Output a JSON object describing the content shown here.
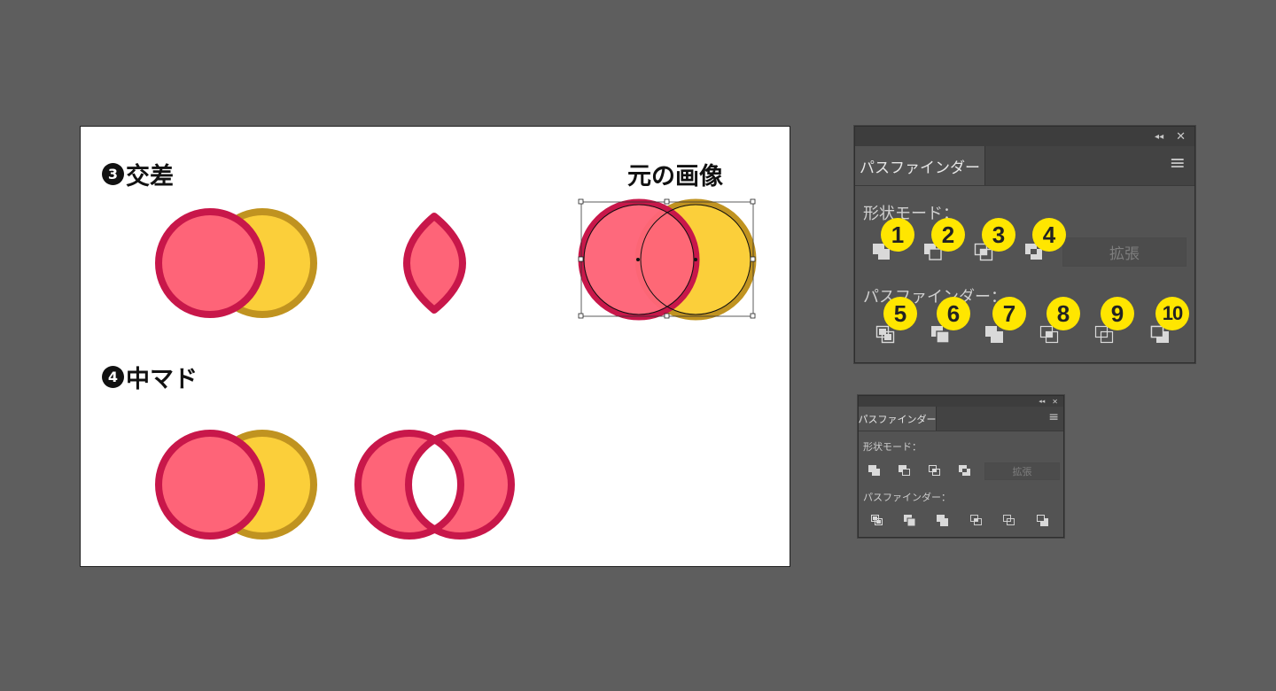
{
  "artboard": {
    "label_intersect_num": "3",
    "label_intersect": "交差",
    "label_original": "元の画像",
    "label_minus_back_num": "4",
    "label_minus_back": "中マド"
  },
  "colors": {
    "red_fill": "#fe6478",
    "red_stroke": "#c8174a",
    "yellow_fill": "#fbcf3a",
    "yellow_stroke": "#c09320",
    "marker": "#ffe600",
    "panel_bg": "#535353"
  },
  "panel_large": {
    "collapse_icon": "double-chevron-left-icon",
    "close_icon": "close-icon",
    "collapse_glyph": "◂◂",
    "close_glyph": "✕",
    "tab_label": "パスファインダー",
    "menu_glyph": "≡",
    "shape_modes_label": "形状モード：",
    "pathfinders_label": "パスファインダー：",
    "expand_label": "拡張",
    "markers": [
      "1",
      "2",
      "3",
      "4",
      "5",
      "6",
      "7",
      "8",
      "9",
      "10"
    ]
  },
  "panel_small": {
    "collapse_glyph": "◂◂",
    "close_glyph": "✕",
    "tab_label": "パスファインダー",
    "menu_glyph": "≡",
    "shape_modes_label": "形状モード：",
    "pathfinders_label": "パスファインダー：",
    "expand_label": "拡張"
  }
}
